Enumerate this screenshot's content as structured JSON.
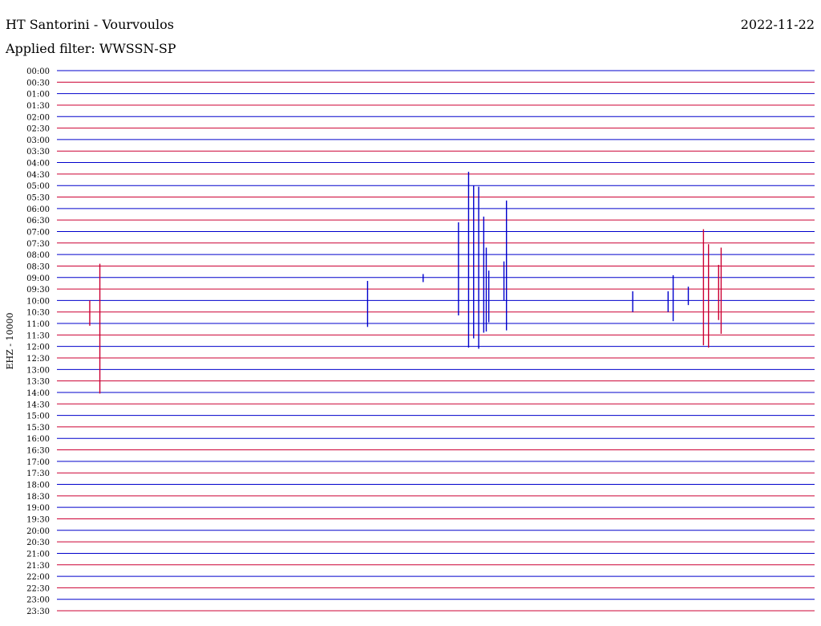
{
  "header": {
    "station": "HT Santorini - Vourvoulos",
    "date": "2022-11-22",
    "filter": "Applied filter: WWSSN-SP"
  },
  "chart_data": {
    "type": "line",
    "title": "HT Santorini - Vourvoulos",
    "ylabel": "EHZ - 10000",
    "row_colors": [
      "#0000cc",
      "#cc0033"
    ],
    "rows": [
      "00:00",
      "00:30",
      "01:00",
      "01:30",
      "02:00",
      "02:30",
      "03:00",
      "03:30",
      "04:00",
      "04:30",
      "05:00",
      "05:30",
      "06:00",
      "06:30",
      "07:00",
      "07:30",
      "08:00",
      "08:30",
      "09:00",
      "09:30",
      "10:00",
      "10:30",
      "11:00",
      "11:30",
      "12:00",
      "12:30",
      "13:00",
      "13:30",
      "14:00",
      "14:30",
      "15:00",
      "15:30",
      "16:00",
      "16:30",
      "17:00",
      "17:30",
      "18:00",
      "18:30",
      "19:00",
      "19:30",
      "20:00",
      "20:30",
      "21:00",
      "21:30",
      "22:00",
      "22:30",
      "23:00",
      "23:30"
    ],
    "x_unit": "minutes after trace start",
    "xlim": [
      0,
      30
    ],
    "events": [
      {
        "row": "10:00",
        "minute": 1.3,
        "color": "#cc0033",
        "up": 0.0,
        "down": 2.2,
        "name": "ev-10-a"
      },
      {
        "row": "09:30",
        "minute": 1.7,
        "color": "#cc0033",
        "up": 2.2,
        "down": 9.1,
        "name": "ev-0930-a"
      },
      {
        "row": "10:00",
        "minute": 12.3,
        "color": "#0000cc",
        "up": 1.7,
        "down": 2.3,
        "name": "ev-10-b"
      },
      {
        "row": "09:00",
        "minute": 14.5,
        "color": "#0000cc",
        "up": 0.3,
        "down": 0.4,
        "name": "ev-09-a"
      },
      {
        "row": "10:00",
        "minute": 15.9,
        "color": "#0000cc",
        "up": 6.8,
        "down": 1.3,
        "name": "ev-10-c"
      },
      {
        "row": "10:00",
        "minute": 16.3,
        "color": "#0000cc",
        "up": 11.2,
        "down": 4.1,
        "name": "ev-10-d"
      },
      {
        "row": "10:00",
        "minute": 16.5,
        "color": "#0000cc",
        "up": 10.0,
        "down": 3.3,
        "name": "ev-10-e"
      },
      {
        "row": "10:00",
        "minute": 16.7,
        "color": "#0000cc",
        "up": 9.9,
        "down": 4.2,
        "name": "ev-10-f"
      },
      {
        "row": "10:00",
        "minute": 16.9,
        "color": "#0000cc",
        "up": 7.3,
        "down": 2.8,
        "name": "ev-10-g"
      },
      {
        "row": "10:00",
        "minute": 17.0,
        "color": "#0000cc",
        "up": 4.6,
        "down": 2.7,
        "name": "ev-10-h"
      },
      {
        "row": "10:00",
        "minute": 17.1,
        "color": "#0000cc",
        "up": 2.6,
        "down": 1.9,
        "name": "ev-10-i"
      },
      {
        "row": "10:00",
        "minute": 17.7,
        "color": "#0000cc",
        "up": 3.4,
        "down": 0.0,
        "name": "ev-10-j"
      },
      {
        "row": "10:00",
        "minute": 17.8,
        "color": "#0000cc",
        "up": 8.7,
        "down": 2.6,
        "name": "ev-10-k"
      },
      {
        "row": "10:00",
        "minute": 22.8,
        "color": "#0000cc",
        "up": 0.8,
        "down": 1.0,
        "name": "ev-10-l"
      },
      {
        "row": "10:00",
        "minute": 24.2,
        "color": "#0000cc",
        "up": 0.8,
        "down": 1.0,
        "name": "ev-10-m"
      },
      {
        "row": "10:00",
        "minute": 24.4,
        "color": "#0000cc",
        "up": 2.2,
        "down": 1.8,
        "name": "ev-10-n"
      },
      {
        "row": "10:00",
        "minute": 25.0,
        "color": "#0000cc",
        "up": 1.2,
        "down": 0.4,
        "name": "ev-10-o"
      },
      {
        "row": "10:00",
        "minute": 25.6,
        "color": "#cc0033",
        "up": 6.2,
        "down": 3.9,
        "name": "ev-10-p"
      },
      {
        "row": "10:00",
        "minute": 25.8,
        "color": "#cc0033",
        "up": 4.9,
        "down": 4.1,
        "name": "ev-10-q"
      },
      {
        "row": "10:00",
        "minute": 26.2,
        "color": "#cc0033",
        "up": 3.1,
        "down": 1.7,
        "name": "ev-10-r"
      },
      {
        "row": "10:00",
        "minute": 26.3,
        "color": "#cc0033",
        "up": 4.6,
        "down": 2.9,
        "name": "ev-10-s"
      }
    ]
  }
}
